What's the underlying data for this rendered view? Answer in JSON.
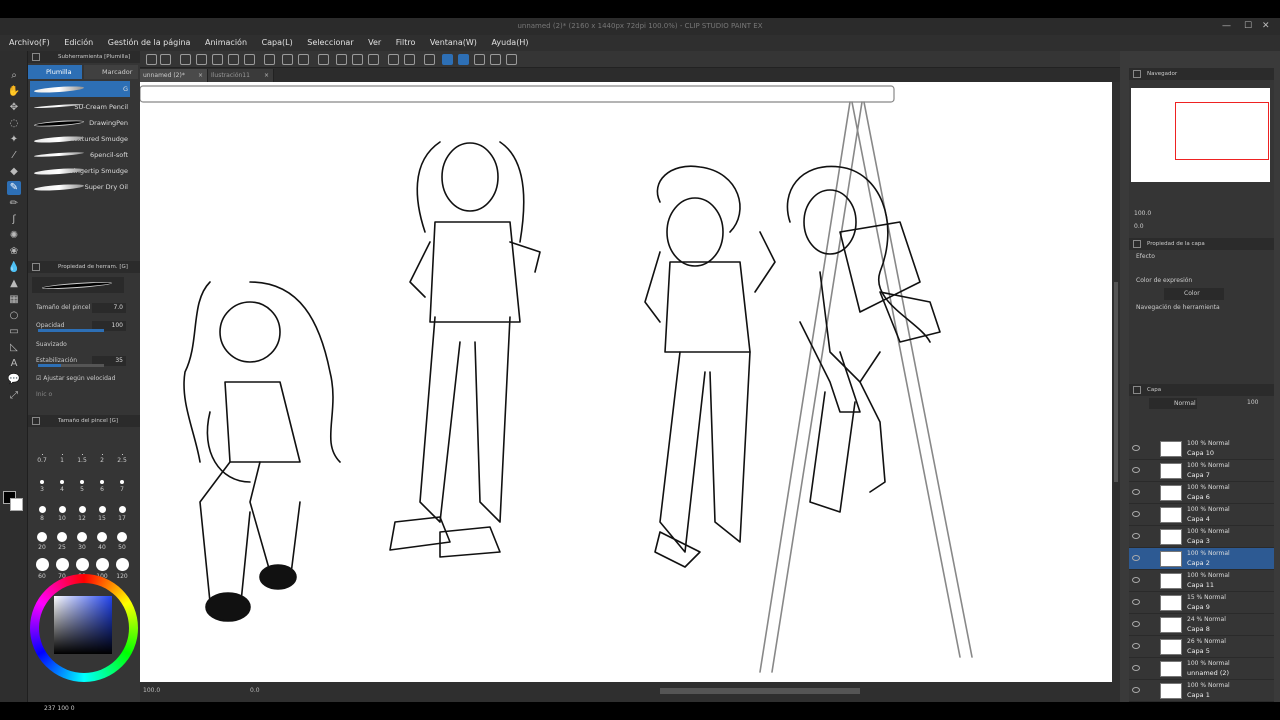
{
  "window": {
    "title": "unnamed (2)* (2160 x 1440px 72dpi 100.0%) - CLIP STUDIO PAINT EX"
  },
  "menu": [
    "Archivo(F)",
    "Edición",
    "Gestión de la página",
    "Animación",
    "Capa(L)",
    "Seleccionar",
    "Ver",
    "Filtro",
    "Ventana(W)",
    "Ayuda(H)"
  ],
  "doc_tabs": [
    "unnamed (2)*",
    "Ilustración11"
  ],
  "subtool": {
    "header": "Subherramienta [Plumilla]",
    "tabs": [
      "Plumilla",
      "Marcador"
    ],
    "brushes": [
      "G",
      "SU-Cream Pencil",
      "DrawingPen",
      "Textured Smudge",
      "6pencil-soft",
      "Fingertip Smudge",
      "Super Dry Oil"
    ]
  },
  "tool_property": {
    "header": "Propiedad de herram. [G]",
    "brush_size_label": "Tamaño del pincel",
    "brush_size_value": "7.0",
    "opacity_label": "Opacidad",
    "opacity_value": "100",
    "antialias_label": "Suavizado",
    "stabilization_label": "Estabilización",
    "stabilization_value": "35",
    "speed_label": "Ajustar según velocidad",
    "extra_label": "Inic o"
  },
  "brush_size_panel": {
    "header": "Tamaño del pincel [G]",
    "sizes": [
      "0.7",
      "1",
      "1.5",
      "2",
      "2.5",
      "3",
      "4",
      "5",
      "6",
      "7",
      "8",
      "10",
      "12",
      "15",
      "17",
      "20",
      "25",
      "30",
      "40",
      "50",
      "60",
      "70",
      "80",
      "100",
      "120"
    ]
  },
  "color": {
    "status": "237",
    "status2": "100",
    "status3": "0"
  },
  "navigator": {
    "header": "Navegador",
    "zoom": "100.0",
    "angle": "0.0"
  },
  "layer_property": {
    "header": "Propiedad de la capa",
    "effect": "Efecto",
    "expression_color": "Color de expresión",
    "color_value": "Color",
    "tool_nav": "Navegación de herramienta"
  },
  "layers_panel": {
    "header": "Capa",
    "blend_mode": "Normal",
    "opacity": "100"
  },
  "layers": [
    {
      "mode": "100 % Normal",
      "name": "Capa 10",
      "selected": false
    },
    {
      "mode": "100 % Normal",
      "name": "Capa 7",
      "selected": false
    },
    {
      "mode": "100 % Normal",
      "name": "Capa 6",
      "selected": false
    },
    {
      "mode": "100 % Normal",
      "name": "Capa 4",
      "selected": false
    },
    {
      "mode": "100 % Normal",
      "name": "Capa 3",
      "selected": false
    },
    {
      "mode": "100 % Normal",
      "name": "Capa 2",
      "selected": true
    },
    {
      "mode": "100 % Normal",
      "name": "Capa 11",
      "selected": false
    },
    {
      "mode": "15 % Normal",
      "name": "Capa 9",
      "selected": false
    },
    {
      "mode": "24 % Normal",
      "name": "Capa 8",
      "selected": false
    },
    {
      "mode": "26 % Normal",
      "name": "Capa 5",
      "selected": false
    },
    {
      "mode": "100 % Normal",
      "name": "unnamed (2)",
      "selected": false
    },
    {
      "mode": "100 % Normal",
      "name": "Capa 1",
      "selected": false
    }
  ],
  "canvas_footer": {
    "zoom": "100.0",
    "angle": "0.0"
  },
  "colors": {
    "accent": "#2d6fb5",
    "panel": "#353535",
    "dark": "#2b2b2b"
  }
}
